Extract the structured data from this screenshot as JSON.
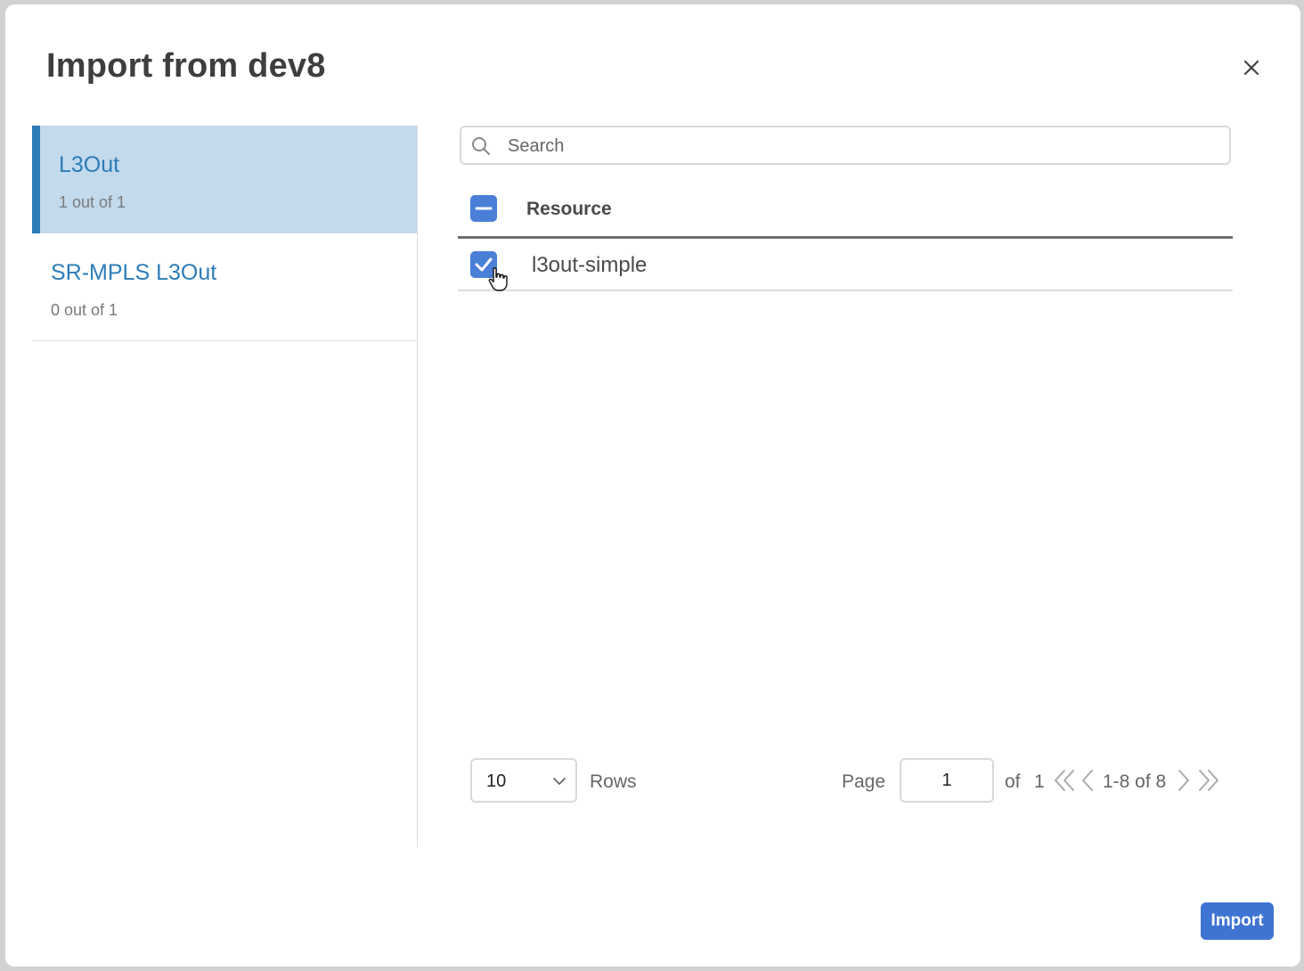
{
  "dialog": {
    "title": "Import from dev8",
    "close_icon": "close-icon"
  },
  "sidebar": {
    "items": [
      {
        "label": "L3Out",
        "count": "1 out of 1",
        "active": true
      },
      {
        "label": "SR-MPLS L3Out",
        "count": "0 out of 1",
        "active": false
      }
    ]
  },
  "search": {
    "placeholder": "Search",
    "value": "",
    "icon": "search-icon"
  },
  "table": {
    "header": {
      "label": "Resource",
      "select_all_state": "indeterminate"
    },
    "rows": [
      {
        "label": "l3out-simple",
        "checked": true
      }
    ]
  },
  "pagination": {
    "rows_per_page": "10",
    "rows_label": "Rows",
    "page_label": "Page",
    "page_value": "1",
    "of_label": "of",
    "total_pages": "1",
    "range": "1-8 of 8"
  },
  "footer": {
    "import_label": "Import"
  },
  "colors": {
    "accent": "#3f74d3",
    "sidebar_active_bg": "#c3d9ec",
    "sidebar_active_border": "#2c7db8",
    "link_text": "#2c7db8"
  }
}
